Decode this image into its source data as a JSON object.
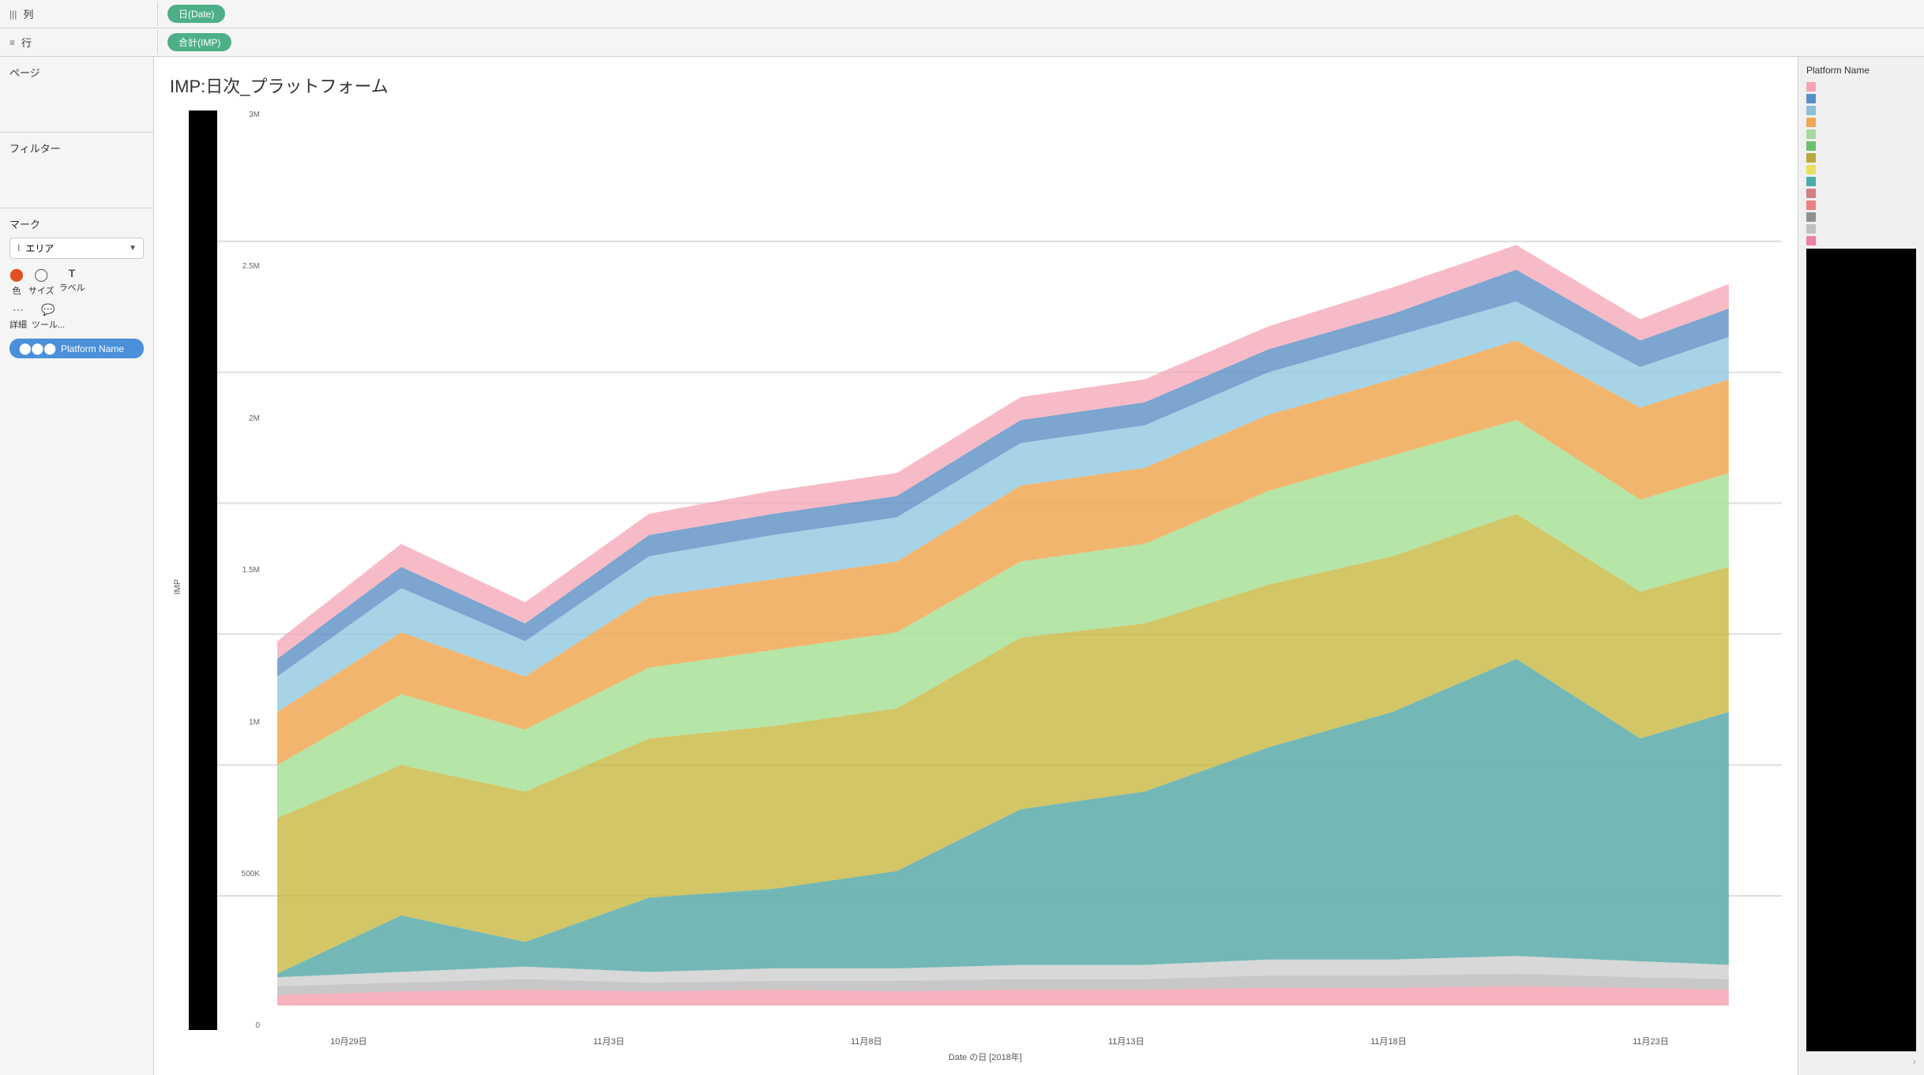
{
  "toolbar": {
    "rows": [
      {
        "icon": "|||",
        "label": "列",
        "pill": "日(Date)"
      },
      {
        "icon": "≡",
        "label": "行",
        "pill": "合計(IMP)"
      }
    ]
  },
  "sidebar": {
    "page_label": "ページ",
    "filter_label": "フィルター",
    "marks_label": "マーク",
    "marks_dropdown": "エリア",
    "controls": [
      {
        "icon": "⬤⬤⬤",
        "label": "色"
      },
      {
        "icon": "○",
        "label": "サイズ"
      },
      {
        "icon": "T",
        "label": "ラベル"
      }
    ],
    "controls2": [
      {
        "icon": "⣿",
        "label": "詳細"
      },
      {
        "icon": "☐",
        "label": "ツール..."
      }
    ],
    "platform_pill": "Platform Name"
  },
  "chart": {
    "title": "IMP:日次_プラットフォーム",
    "y_axis_label": "IMP",
    "x_axis_label": "Date の日 [2018年]",
    "x_ticks": [
      "10月29日",
      "11月3日",
      "11月8日",
      "11月13日",
      "11月18日",
      "11月23日"
    ],
    "y_ticks": [
      "0",
      "500K",
      "1M",
      "1.5M",
      "2M",
      "2.5M",
      "3M"
    ]
  },
  "legend": {
    "title": "Platform Name",
    "items": [
      {
        "color": "#f4a4a4",
        "label": ""
      },
      {
        "color": "#5b8ec4",
        "label": ""
      },
      {
        "color": "#8bbfd6",
        "label": ""
      },
      {
        "color": "#f0a855",
        "label": ""
      },
      {
        "color": "#a8d8a0",
        "label": ""
      },
      {
        "color": "#6cbf6c",
        "label": ""
      },
      {
        "color": "#b8a840",
        "label": ""
      },
      {
        "color": "#e8e060",
        "label": ""
      },
      {
        "color": "#4aacaa",
        "label": ""
      },
      {
        "color": "#d08080",
        "label": ""
      },
      {
        "color": "#e88080",
        "label": ""
      },
      {
        "color": "#909090",
        "label": ""
      },
      {
        "color": "#c0c0c0",
        "label": ""
      },
      {
        "color": "#f080a0",
        "label": ""
      }
    ]
  }
}
